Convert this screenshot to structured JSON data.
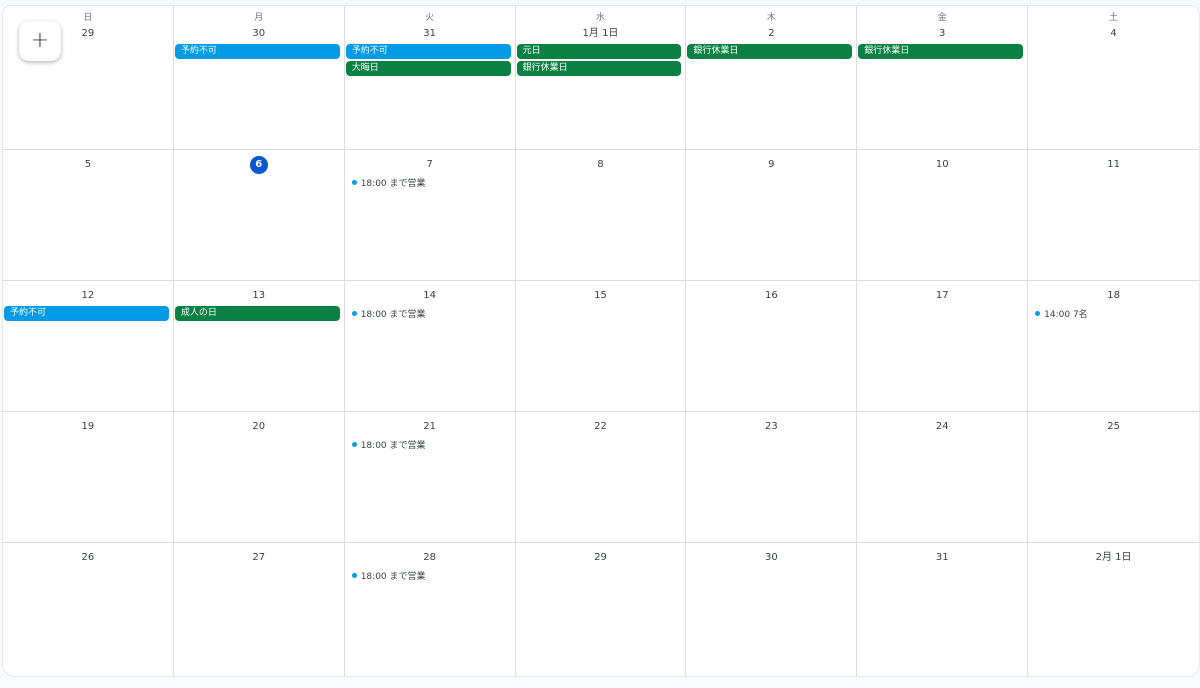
{
  "weekdays": [
    "日",
    "月",
    "火",
    "水",
    "木",
    "金",
    "土"
  ],
  "create_button": {
    "icon": "plus-icon",
    "glyph": "+"
  },
  "today_label": "6",
  "colors": {
    "blue": "#039be5",
    "green": "#0b8043",
    "today": "#0b57d0"
  },
  "weeks": [
    [
      {
        "label": "29",
        "events": []
      },
      {
        "label": "30",
        "events": [
          {
            "kind": "chip",
            "color": "blue",
            "text": "予約不可"
          }
        ]
      },
      {
        "label": "31",
        "events": [
          {
            "kind": "chip",
            "color": "blue",
            "text": "予約不可"
          },
          {
            "kind": "chip",
            "color": "green",
            "text": "大晦日"
          }
        ]
      },
      {
        "label": "1月 1日",
        "events": [
          {
            "kind": "chip",
            "color": "green",
            "text": "元日"
          },
          {
            "kind": "chip",
            "color": "green",
            "text": "銀行休業日"
          }
        ]
      },
      {
        "label": "2",
        "events": [
          {
            "kind": "chip",
            "color": "green",
            "text": "銀行休業日"
          }
        ]
      },
      {
        "label": "3",
        "events": [
          {
            "kind": "chip",
            "color": "green",
            "text": "銀行休業日"
          }
        ]
      },
      {
        "label": "4",
        "events": []
      }
    ],
    [
      {
        "label": "5",
        "events": []
      },
      {
        "label": "6",
        "today": true,
        "events": []
      },
      {
        "label": "7",
        "events": [
          {
            "kind": "dot",
            "text": "18:00 まで営業"
          }
        ]
      },
      {
        "label": "8",
        "events": []
      },
      {
        "label": "9",
        "events": []
      },
      {
        "label": "10",
        "events": []
      },
      {
        "label": "11",
        "events": []
      }
    ],
    [
      {
        "label": "12",
        "events": [
          {
            "kind": "chip",
            "color": "blue",
            "text": "予約不可"
          }
        ]
      },
      {
        "label": "13",
        "events": [
          {
            "kind": "chip",
            "color": "green",
            "text": "成人の日"
          }
        ]
      },
      {
        "label": "14",
        "events": [
          {
            "kind": "dot",
            "text": "18:00 まで営業"
          }
        ]
      },
      {
        "label": "15",
        "events": []
      },
      {
        "label": "16",
        "events": []
      },
      {
        "label": "17",
        "events": []
      },
      {
        "label": "18",
        "events": [
          {
            "kind": "dot",
            "text": "14:00 7名"
          }
        ]
      }
    ],
    [
      {
        "label": "19",
        "events": []
      },
      {
        "label": "20",
        "events": []
      },
      {
        "label": "21",
        "events": [
          {
            "kind": "dot",
            "text": "18:00 まで営業"
          }
        ]
      },
      {
        "label": "22",
        "events": []
      },
      {
        "label": "23",
        "events": []
      },
      {
        "label": "24",
        "events": []
      },
      {
        "label": "25",
        "events": []
      }
    ],
    [
      {
        "label": "26",
        "events": []
      },
      {
        "label": "27",
        "events": []
      },
      {
        "label": "28",
        "events": [
          {
            "kind": "dot",
            "text": "18:00 まで営業"
          }
        ]
      },
      {
        "label": "29",
        "events": []
      },
      {
        "label": "30",
        "events": []
      },
      {
        "label": "31",
        "events": []
      },
      {
        "label": "2月 1日",
        "events": []
      }
    ]
  ]
}
